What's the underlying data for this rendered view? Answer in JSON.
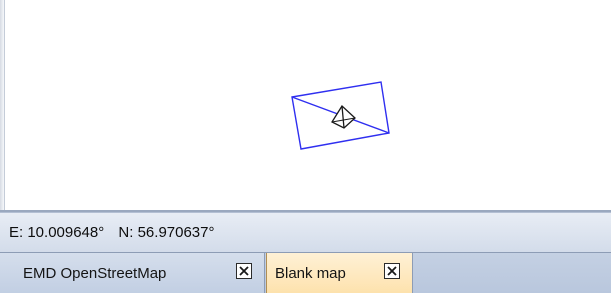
{
  "status_bar": {
    "easting": "E: 10.009648°",
    "northing": "N: 56.970637°"
  },
  "tabs": [
    {
      "label": "EMD OpenStreetMap",
      "active": false,
      "close_icon": "close-icon"
    },
    {
      "label": "Blank map",
      "active": true,
      "close_icon": "close-icon"
    }
  ],
  "map": {
    "feature": "rectangle-with-diagonal",
    "marker_icon": "pyramid-icon",
    "outline_color": "#2f2ff0",
    "marker_color": "#1a1a1a"
  }
}
